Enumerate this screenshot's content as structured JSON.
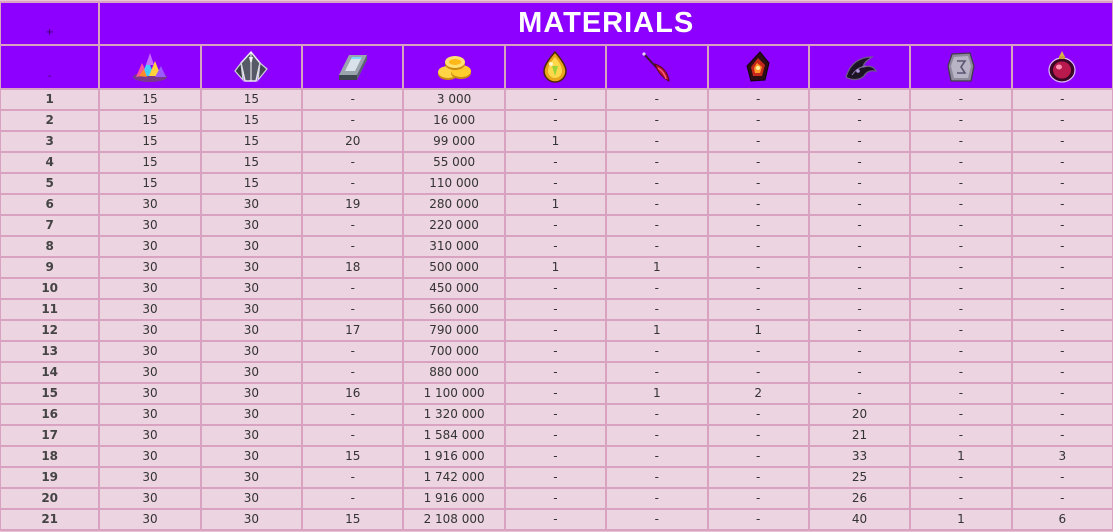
{
  "header": {
    "plus": "+",
    "minus": "-",
    "title": "MATERIALS"
  },
  "icons": [
    "crystal-pile-icon",
    "dark-crystal-icon",
    "metal-bar-icon",
    "gold-coins-icon",
    "amber-gem-icon",
    "crimson-feather-icon",
    "fire-stone-icon",
    "dark-claw-icon",
    "rune-stone-icon",
    "crimson-orb-icon"
  ],
  "colors": {
    "header_bg": "#8d00ff",
    "cell_bg": "#ecd4e0",
    "border": "#d8a2c0"
  },
  "rows": [
    {
      "level": "1",
      "values": [
        "15",
        "15",
        "-",
        "3 000",
        "-",
        "-",
        "-",
        "-",
        "-",
        "-"
      ]
    },
    {
      "level": "2",
      "values": [
        "15",
        "15",
        "-",
        "16 000",
        "-",
        "-",
        "-",
        "-",
        "-",
        "-"
      ]
    },
    {
      "level": "3",
      "values": [
        "15",
        "15",
        "20",
        "99 000",
        "1",
        "-",
        "-",
        "-",
        "-",
        "-"
      ]
    },
    {
      "level": "4",
      "values": [
        "15",
        "15",
        "-",
        "55 000",
        "-",
        "-",
        "-",
        "-",
        "-",
        "-"
      ]
    },
    {
      "level": "5",
      "values": [
        "15",
        "15",
        "-",
        "110 000",
        "-",
        "-",
        "-",
        "-",
        "-",
        "-"
      ]
    },
    {
      "level": "6",
      "values": [
        "30",
        "30",
        "19",
        "280 000",
        "1",
        "-",
        "-",
        "-",
        "-",
        "-"
      ]
    },
    {
      "level": "7",
      "values": [
        "30",
        "30",
        "-",
        "220 000",
        "-",
        "-",
        "-",
        "-",
        "-",
        "-"
      ]
    },
    {
      "level": "8",
      "values": [
        "30",
        "30",
        "-",
        "310 000",
        "-",
        "-",
        "-",
        "-",
        "-",
        "-"
      ]
    },
    {
      "level": "9",
      "values": [
        "30",
        "30",
        "18",
        "500 000",
        "1",
        "1",
        "-",
        "-",
        "-",
        "-"
      ]
    },
    {
      "level": "10",
      "values": [
        "30",
        "30",
        "-",
        "450 000",
        "-",
        "-",
        "-",
        "-",
        "-",
        "-"
      ]
    },
    {
      "level": "11",
      "values": [
        "30",
        "30",
        "-",
        "560 000",
        "-",
        "-",
        "-",
        "-",
        "-",
        "-"
      ]
    },
    {
      "level": "12",
      "values": [
        "30",
        "30",
        "17",
        "790 000",
        "-",
        "1",
        "1",
        "-",
        "-",
        "-"
      ]
    },
    {
      "level": "13",
      "values": [
        "30",
        "30",
        "-",
        "700 000",
        "-",
        "-",
        "-",
        "-",
        "-",
        "-"
      ]
    },
    {
      "level": "14",
      "values": [
        "30",
        "30",
        "-",
        "880 000",
        "-",
        "-",
        "-",
        "-",
        "-",
        "-"
      ]
    },
    {
      "level": "15",
      "values": [
        "30",
        "30",
        "16",
        "1 100 000",
        "-",
        "1",
        "2",
        "-",
        "-",
        "-"
      ]
    },
    {
      "level": "16",
      "values": [
        "30",
        "30",
        "-",
        "1 320 000",
        "-",
        "-",
        "-",
        "20",
        "-",
        "-"
      ]
    },
    {
      "level": "17",
      "values": [
        "30",
        "30",
        "-",
        "1 584 000",
        "-",
        "-",
        "-",
        "21",
        "-",
        "-"
      ]
    },
    {
      "level": "18",
      "values": [
        "30",
        "30",
        "15",
        "1 916 000",
        "-",
        "-",
        "-",
        "33",
        "1",
        "3"
      ]
    },
    {
      "level": "19",
      "values": [
        "30",
        "30",
        "-",
        "1 742 000",
        "-",
        "-",
        "-",
        "25",
        "-",
        "-"
      ]
    },
    {
      "level": "20",
      "values": [
        "30",
        "30",
        "-",
        "1 916 000",
        "-",
        "-",
        "-",
        "26",
        "-",
        "-"
      ]
    },
    {
      "level": "21",
      "values": [
        "30",
        "30",
        "15",
        "2 108 000",
        "-",
        "-",
        "-",
        "40",
        "1",
        "6"
      ]
    }
  ]
}
